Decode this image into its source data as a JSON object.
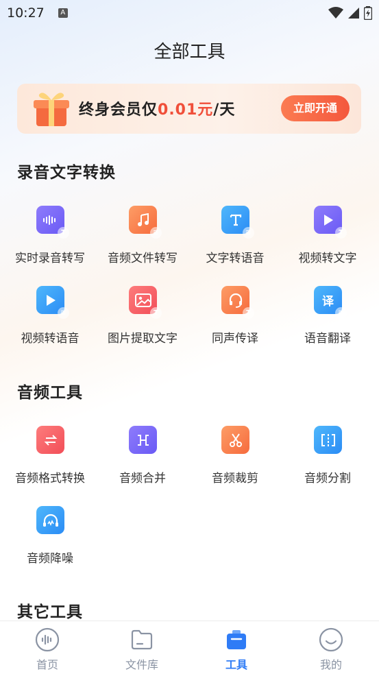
{
  "status": {
    "time": "10:27",
    "indicator": "A"
  },
  "header": {
    "title": "全部工具"
  },
  "promo": {
    "text_prefix": "终身会员仅",
    "price": "0.01元",
    "text_suffix": "/天",
    "button_label": "立即开通"
  },
  "sections": [
    {
      "title": "录音文字转换",
      "tools": [
        {
          "label": "实时录音转写",
          "icon": "waveform-icon"
        },
        {
          "label": "音频文件转写",
          "icon": "music-note-icon"
        },
        {
          "label": "文字转语音",
          "icon": "text-t-icon"
        },
        {
          "label": "视频转文字",
          "icon": "play-icon"
        },
        {
          "label": "视频转语音",
          "icon": "play-icon"
        },
        {
          "label": "图片提取文字",
          "icon": "image-icon"
        },
        {
          "label": "同声传译",
          "icon": "headset-icon"
        },
        {
          "label": "语音翻译",
          "icon": "translate-icon",
          "glyph": "译"
        }
      ]
    },
    {
      "title": "音频工具",
      "tools": [
        {
          "label": "音频格式转换",
          "icon": "swap-arrows-icon"
        },
        {
          "label": "音频合并",
          "icon": "merge-icon"
        },
        {
          "label": "音频裁剪",
          "icon": "scissors-icon"
        },
        {
          "label": "音频分割",
          "icon": "split-icon"
        },
        {
          "label": "音频降噪",
          "icon": "noise-reduction-icon"
        }
      ]
    },
    {
      "title": "其它工具",
      "tools": []
    }
  ],
  "bottom_nav": [
    {
      "label": "首页",
      "icon": "home-wave-icon",
      "active": false
    },
    {
      "label": "文件库",
      "icon": "folder-icon",
      "active": false
    },
    {
      "label": "工具",
      "icon": "toolbox-icon",
      "active": true
    },
    {
      "label": "我的",
      "icon": "smile-icon",
      "active": false
    }
  ],
  "colors": {
    "accent": "#2f7cf6",
    "promo_price": "#f04f3a",
    "promo_button": "#f4583d"
  }
}
